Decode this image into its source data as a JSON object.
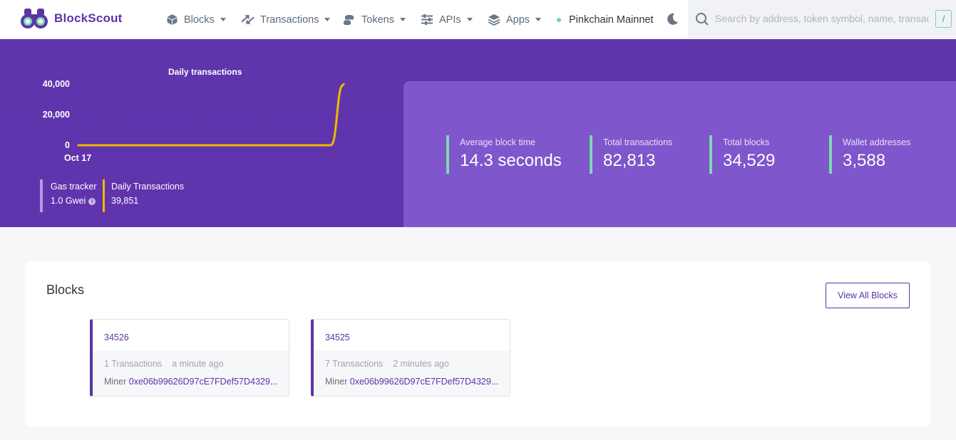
{
  "header": {
    "brand": "BlockScout",
    "nav": [
      {
        "label": "Blocks",
        "icon": "cube-icon"
      },
      {
        "label": "Transactions",
        "icon": "arrows-icon"
      },
      {
        "label": "Tokens",
        "icon": "coins-icon"
      },
      {
        "label": "APIs",
        "icon": "sliders-icon"
      },
      {
        "label": "Apps",
        "icon": "layers-icon"
      }
    ],
    "network": "Pinkchain Mainnet",
    "search_placeholder": "Search by address, token symbol, name, transaction hash, or block number",
    "search_shortcut": "/"
  },
  "hero": {
    "chart_title": "Daily transactions",
    "gas_label": "Gas tracker",
    "gas_value": "1.0 Gwei",
    "daily_tx_label": "Daily Transactions",
    "daily_tx_value": "39,851"
  },
  "chart_data": {
    "type": "line",
    "title": "Daily transactions",
    "x_start_label": "Oct 17",
    "y_ticks": [
      "40,000",
      "20,000",
      "0"
    ],
    "ylim": [
      0,
      40000
    ],
    "grid": false,
    "series": [
      {
        "color": "#f2b800",
        "points": [
          0,
          0,
          0,
          0,
          0,
          0,
          0,
          0,
          0,
          0,
          0,
          0,
          0,
          0,
          0,
          0,
          0,
          0,
          0,
          0,
          0,
          0,
          0,
          0,
          0,
          0,
          0,
          0,
          0,
          0,
          0,
          0,
          0,
          0,
          0,
          0,
          0,
          0,
          0,
          0,
          0,
          0,
          0,
          0,
          0,
          0,
          0,
          0,
          0,
          0,
          0,
          0,
          0,
          0,
          0,
          0,
          0,
          0,
          0,
          0,
          0,
          0,
          0,
          0,
          0,
          0,
          0,
          0,
          0,
          0,
          0,
          0,
          0,
          0,
          0,
          0,
          0,
          0,
          0,
          0,
          0,
          0,
          0,
          0,
          0,
          0,
          0,
          0,
          0,
          0,
          0,
          0,
          0,
          0,
          0,
          0,
          0,
          0,
          0,
          0,
          0,
          0,
          0,
          0,
          0,
          0,
          0,
          0,
          0,
          0,
          0,
          0,
          0,
          0,
          0,
          0,
          0,
          0,
          0,
          0,
          0,
          0,
          0,
          0,
          0,
          0,
          0,
          0,
          0,
          0,
          0,
          0,
          0,
          0,
          0,
          0,
          0,
          0,
          0,
          0,
          0,
          0,
          0,
          0,
          0,
          0,
          0,
          0,
          0,
          0,
          0,
          0,
          0,
          0,
          0,
          0,
          0,
          0,
          0,
          0,
          0,
          0,
          0,
          0,
          0,
          0,
          0,
          0,
          0,
          0,
          0,
          0,
          0,
          0,
          0,
          0,
          0,
          0,
          0,
          0,
          0,
          0,
          0,
          0,
          0,
          0,
          0,
          0,
          0,
          0,
          0,
          0,
          0,
          0,
          0,
          0,
          0,
          0,
          0,
          0,
          0,
          0,
          0,
          0,
          0,
          0,
          0,
          0,
          0,
          0,
          0,
          0,
          0,
          0,
          0,
          0,
          0,
          0,
          0,
          0,
          0,
          0,
          0,
          0,
          0,
          0,
          0,
          0,
          0,
          0,
          0,
          0,
          0,
          0,
          0,
          0,
          0,
          0,
          0,
          0,
          0,
          0,
          0,
          0,
          0,
          0,
          0,
          0,
          0,
          0,
          0,
          0,
          0,
          0,
          0,
          0,
          0,
          0,
          0,
          0,
          0,
          0,
          0,
          0,
          0,
          0,
          0,
          0,
          0,
          0,
          0,
          0,
          0,
          0,
          0,
          0,
          0,
          0,
          0,
          0,
          0,
          0,
          0,
          0,
          0,
          0,
          0,
          0,
          0,
          0,
          200,
          800,
          2000,
          4000,
          7500,
          12000,
          17500,
          23000,
          28500,
          33000,
          36000,
          37800,
          38800,
          39400,
          39851
        ]
      }
    ]
  },
  "stats": [
    {
      "label": "Average block time",
      "value": "14.3 seconds"
    },
    {
      "label": "Total transactions",
      "value": "82,813"
    },
    {
      "label": "Total blocks",
      "value": "34,529"
    },
    {
      "label": "Wallet addresses",
      "value": "3,588"
    }
  ],
  "blocks": {
    "title": "Blocks",
    "view_all_label": "View All Blocks",
    "items": [
      {
        "number": "34526",
        "tx_count": "1 Transactions",
        "age": "a minute ago",
        "miner_label": "Miner",
        "miner": "0xe06b99626D97cE7FDef57D4329..."
      },
      {
        "number": "34525",
        "tx_count": "7 Transactions",
        "age": "2 minutes ago",
        "miner_label": "Miner",
        "miner": "0xe06b99626D97cE7FDef57D4329..."
      }
    ]
  },
  "colors": {
    "brand": "#5b35a6",
    "hero_bg": "#5f35ab",
    "stats_bg": "#7f56cb",
    "accent_green": "#7ed9b1",
    "chart_line": "#f2b800"
  }
}
